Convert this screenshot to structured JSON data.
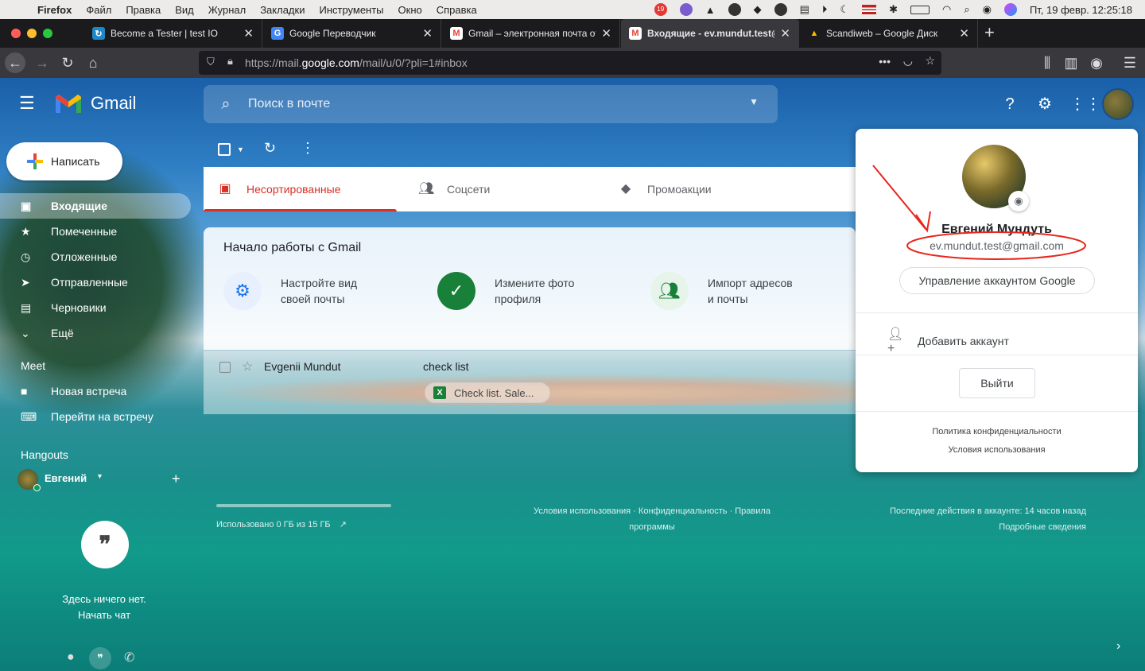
{
  "menubar": {
    "app": "Firefox",
    "items": [
      "Файл",
      "Правка",
      "Вид",
      "Журнал",
      "Закладки",
      "Инструменты",
      "Окно",
      "Справка"
    ],
    "badge": "19",
    "clock": "Пт, 19 февр.  12:25:18"
  },
  "tabs": [
    {
      "title": "Become a Tester | test IO",
      "icon": "testio-icon",
      "color": "#1e88c7",
      "glyph": "↻"
    },
    {
      "title": "Google Переводчик",
      "icon": "translate-icon",
      "color": "#4285f4",
      "glyph": "G"
    },
    {
      "title": "Gmail – электронная почта от",
      "icon": "gmail-icon",
      "color": "#ea4335",
      "glyph": "M"
    },
    {
      "title": "Входящие - ev.mundut.test@gi",
      "icon": "gmail-icon",
      "color": "#ea4335",
      "glyph": "M"
    },
    {
      "title": "Scandiweb – Google Диск",
      "icon": "drive-icon",
      "color": "#fbbc04",
      "glyph": "▲"
    }
  ],
  "url": {
    "pre": "https://mail.",
    "host": "google.com",
    "post": "/mail/u/0/?pli=1#inbox"
  },
  "gmail": {
    "brand": "Gmail",
    "search_placeholder": "Поиск в почте",
    "compose": "Написать",
    "nav": [
      "Входящие",
      "Помеченные",
      "Отложенные",
      "Отправленные",
      "Черновики",
      "Ещё"
    ],
    "meet_title": "Meet",
    "meet": [
      "Новая встреча",
      "Перейти на встречу"
    ],
    "hangouts_title": "Hangouts",
    "hangouts_user": "Евгений",
    "hangouts_empty1": "Здесь ничего нет.",
    "hangouts_empty2": "Начать чат",
    "categories": [
      "Несортированные",
      "Соцсети",
      "Промоакции"
    ],
    "started_title": "Начало работы с Gmail",
    "cards": [
      {
        "line1": "Настройте вид",
        "line2": "своей почты"
      },
      {
        "line1": "Измените фото",
        "line2": "профиля"
      },
      {
        "line1": "Импорт адресов",
        "line2": "и почты"
      }
    ],
    "row": {
      "sender": "Evgenii Mundut",
      "subject": "check list",
      "attachment": "Check list. Sale..."
    },
    "footer": {
      "storage": "Использовано 0 ГБ из 15 ГБ",
      "links1": "Условия использования · Конфиденциальность · Правила",
      "links2": "программы",
      "activity1": "Последние действия в аккаунте: 14 часов назад",
      "activity2": "Подробные сведения"
    }
  },
  "account": {
    "name": "Евгений Мундуть",
    "email": "ev.mundut.test@gmail.com",
    "manage": "Управление аккаунтом Google",
    "add": "Добавить аккаунт",
    "logout": "Выйти",
    "privacy": "Политика конфиденциальности",
    "terms": "Условия использования"
  },
  "colors": {
    "annotation": "#e8261c",
    "accent_red": "#d93025"
  }
}
